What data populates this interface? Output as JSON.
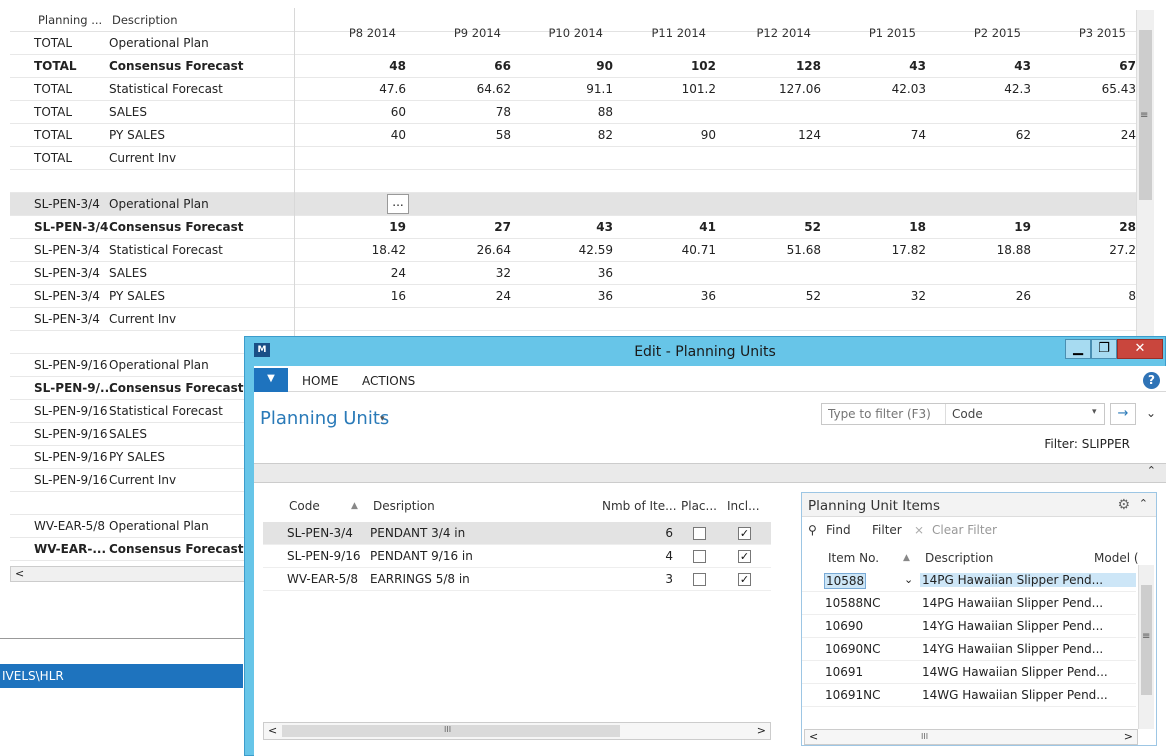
{
  "grid": {
    "headers": {
      "planning": "Planning ...",
      "description": "Description",
      "periods": [
        "P8 2014",
        "P9 2014",
        "P10 2014",
        "P11 2014",
        "P12 2014",
        "P1 2015",
        "P2 2015",
        "P3 2015"
      ]
    },
    "rows": [
      {
        "code": "TOTAL",
        "desc": "Operational Plan",
        "bold": false,
        "vals": [
          "",
          "",
          "",
          "",
          "",
          "",
          "",
          ""
        ]
      },
      {
        "code": "TOTAL",
        "desc": "Consensus Forecast",
        "bold": true,
        "vals": [
          "48",
          "66",
          "90",
          "102",
          "128",
          "43",
          "43",
          "67"
        ]
      },
      {
        "code": "TOTAL",
        "desc": "Statistical Forecast",
        "bold": false,
        "vals": [
          "47.6",
          "64.62",
          "91.1",
          "101.2",
          "127.06",
          "42.03",
          "42.3",
          "65.43"
        ]
      },
      {
        "code": "TOTAL",
        "desc": "SALES",
        "bold": false,
        "vals": [
          "60",
          "78",
          "88",
          "",
          "",
          "",
          "",
          ""
        ]
      },
      {
        "code": "TOTAL",
        "desc": "PY SALES",
        "bold": false,
        "vals": [
          "40",
          "58",
          "82",
          "90",
          "124",
          "74",
          "62",
          "24"
        ]
      },
      {
        "code": "TOTAL",
        "desc": "Current Inv",
        "bold": false,
        "vals": [
          "",
          "",
          "",
          "",
          "",
          "",
          "",
          ""
        ]
      },
      {
        "code": "",
        "desc": "",
        "bold": false,
        "vals": [
          "",
          "",
          "",
          "",
          "",
          "",
          "",
          ""
        ]
      },
      {
        "code": "SL-PEN-3/4",
        "desc": "Operational Plan",
        "bold": false,
        "sel": true,
        "vals": [
          "",
          "",
          "",
          "",
          "",
          "",
          "",
          ""
        ]
      },
      {
        "code": "SL-PEN-3/4",
        "desc": "Consensus Forecast",
        "bold": true,
        "vals": [
          "19",
          "27",
          "43",
          "41",
          "52",
          "18",
          "19",
          "28"
        ]
      },
      {
        "code": "SL-PEN-3/4",
        "desc": "Statistical Forecast",
        "bold": false,
        "vals": [
          "18.42",
          "26.64",
          "42.59",
          "40.71",
          "51.68",
          "17.82",
          "18.88",
          "27.2"
        ]
      },
      {
        "code": "SL-PEN-3/4",
        "desc": "SALES",
        "bold": false,
        "vals": [
          "24",
          "32",
          "36",
          "",
          "",
          "",
          "",
          ""
        ]
      },
      {
        "code": "SL-PEN-3/4",
        "desc": "PY SALES",
        "bold": false,
        "vals": [
          "16",
          "24",
          "36",
          "36",
          "52",
          "32",
          "26",
          "8"
        ]
      },
      {
        "code": "SL-PEN-3/4",
        "desc": "Current Inv",
        "bold": false,
        "vals": [
          "",
          "",
          "",
          "",
          "",
          "",
          "",
          ""
        ]
      },
      {
        "code": "",
        "desc": "",
        "bold": false,
        "vals": [
          "",
          "",
          "",
          "",
          "",
          "",
          "",
          ""
        ]
      },
      {
        "code": "SL-PEN-9/16",
        "desc": "Operational Plan",
        "bold": false,
        "vals": [
          "",
          "",
          "",
          "",
          "",
          "",
          "",
          ""
        ]
      },
      {
        "code": "SL-PEN-9/...",
        "desc": "Consensus Forecast",
        "bold": true,
        "vals": [
          "",
          "",
          "",
          "",
          "",
          "",
          "",
          ""
        ]
      },
      {
        "code": "SL-PEN-9/16",
        "desc": "Statistical Forecast",
        "bold": false,
        "vals": [
          "",
          "",
          "",
          "",
          "",
          "",
          "",
          ""
        ]
      },
      {
        "code": "SL-PEN-9/16",
        "desc": "SALES",
        "bold": false,
        "vals": [
          "",
          "",
          "",
          "",
          "",
          "",
          "",
          ""
        ]
      },
      {
        "code": "SL-PEN-9/16",
        "desc": "PY SALES",
        "bold": false,
        "vals": [
          "",
          "",
          "",
          "",
          "",
          "",
          "",
          ""
        ]
      },
      {
        "code": "SL-PEN-9/16",
        "desc": "Current Inv",
        "bold": false,
        "vals": [
          "",
          "",
          "",
          "",
          "",
          "",
          "",
          ""
        ]
      },
      {
        "code": "",
        "desc": "",
        "bold": false,
        "vals": [
          "",
          "",
          "",
          "",
          "",
          "",
          "",
          ""
        ]
      },
      {
        "code": "WV-EAR-5/8",
        "desc": "Operational Plan",
        "bold": false,
        "vals": [
          "",
          "",
          "",
          "",
          "",
          "",
          "",
          ""
        ]
      },
      {
        "code": "WV-EAR-...",
        "desc": "Consensus Forecast",
        "bold": true,
        "vals": [
          "",
          "",
          "",
          "",
          "",
          "",
          "",
          ""
        ]
      }
    ],
    "ellipsis_button": "...",
    "scroll_left": "<"
  },
  "path_bar": "IVELS\\HLR",
  "dialog": {
    "title": "Edit - Planning Units",
    "win_minimize": "▁",
    "win_maximize": "❐",
    "win_close": "✕",
    "ribbon": {
      "file": "▼",
      "tabs": [
        "HOME",
        "ACTIONS"
      ],
      "help": "?"
    },
    "page_title": "Planning Units",
    "page_caret": "▾",
    "filter": {
      "placeholder": "Type to filter (F3)",
      "field": "Code",
      "dd": "▾",
      "go": "→"
    },
    "expand": "⌄",
    "filter_label": "Filter: SLIPPER",
    "collapse": "⌃",
    "list": {
      "headers": {
        "code": "Code",
        "sort": "▲",
        "desc": "Desription",
        "nmb": "Nmb of Ite...",
        "plac": "Plac...",
        "incl": "Incl..."
      },
      "rows": [
        {
          "code": "SL-PEN-3/4",
          "desc": "PENDANT 3/4 in",
          "nmb": "6",
          "plac": false,
          "incl": true
        },
        {
          "code": "SL-PEN-9/16",
          "desc": "PENDANT 9/16 in",
          "nmb": "4",
          "plac": false,
          "incl": true
        },
        {
          "code": "WV-EAR-5/8",
          "desc": "EARRINGS 5/8 in",
          "nmb": "3",
          "plac": false,
          "incl": true
        }
      ],
      "scroll_left": "<",
      "scroll_right": ">",
      "scroll_grip": "III"
    },
    "items_panel": {
      "title": "Planning Unit Items",
      "gear": "⚙",
      "collapse": "⌃",
      "tools": {
        "find_icon": "⚲",
        "find": "Find",
        "filter": "Filter",
        "clear_icon": "⨯",
        "clear": "Clear Filter"
      },
      "headers": {
        "item": "Item No.",
        "sort": "▲",
        "desc": "Description",
        "model": "Model ("
      },
      "rows": [
        {
          "item": "10588",
          "desc": "14PG Hawaiian Slipper Pend...",
          "sel": true
        },
        {
          "item": "10588NC",
          "desc": "14PG Hawaiian Slipper Pend..."
        },
        {
          "item": "10690",
          "desc": "14YG Hawaiian Slipper Pend..."
        },
        {
          "item": "10690NC",
          "desc": "14YG Hawaiian Slipper Pend..."
        },
        {
          "item": "10691",
          "desc": "14WG Hawaiian Slipper Pend..."
        },
        {
          "item": "10691NC",
          "desc": "14WG Hawaiian Slipper Pend..."
        }
      ],
      "row_dd": "⌄",
      "scroll_left": "<",
      "scroll_right": ">",
      "scroll_grip": "III",
      "scroll_down": "⌄",
      "scroll_up": "⌃"
    }
  },
  "colors": {
    "accent": "#1e73be",
    "dialog_frame": "#67c5e8",
    "close": "#c9463d"
  }
}
